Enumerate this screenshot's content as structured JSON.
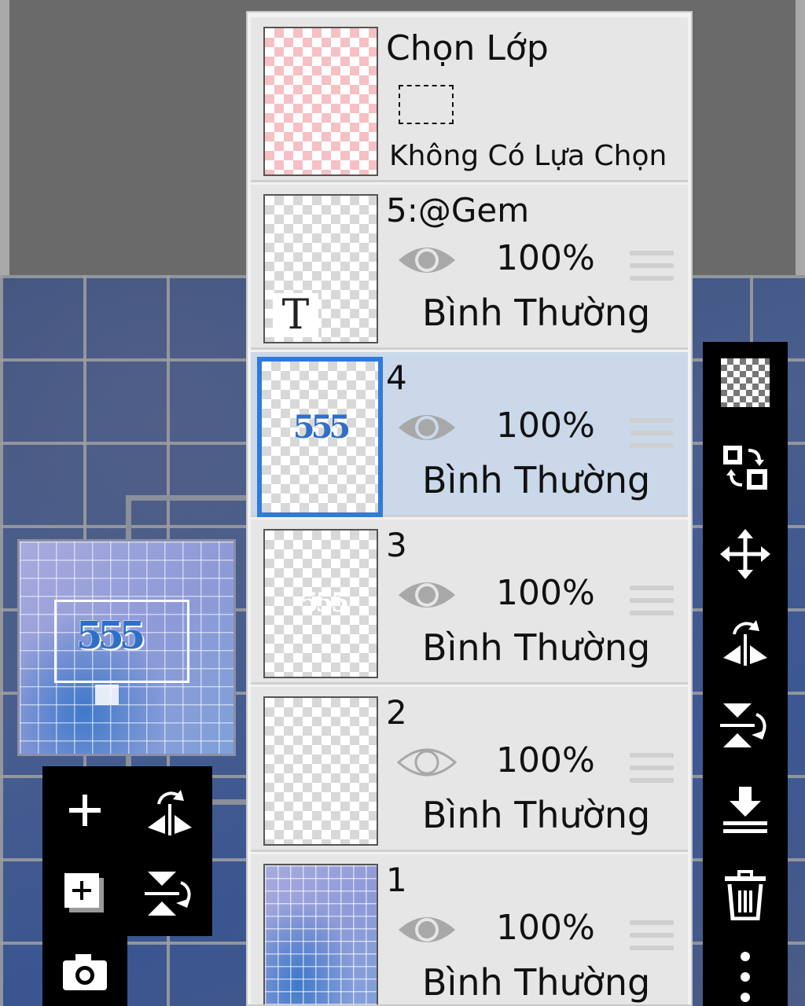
{
  "selection_layer": {
    "title": "Chọn Lớp",
    "status": "Không Có Lựa Chọn"
  },
  "layers": [
    {
      "name": "5:@Gem",
      "opacity": "100%",
      "blend": "Bình Thường",
      "visible": true,
      "selected": false,
      "thumbnail": "text-T"
    },
    {
      "name": "4",
      "opacity": "100%",
      "blend": "Bình Thường",
      "visible": true,
      "selected": true,
      "thumbnail_text": "555"
    },
    {
      "name": "3",
      "opacity": "100%",
      "blend": "Bình Thường",
      "visible": true,
      "selected": false
    },
    {
      "name": "2",
      "opacity": "100%",
      "blend": "Bình Thường",
      "visible": false,
      "selected": false
    },
    {
      "name": "1",
      "opacity": "100%",
      "blend": "Bình Thường",
      "visible": true,
      "selected": false
    }
  ],
  "navigator": {
    "text": "555"
  },
  "colors": {
    "selected_row": "#cad8ea",
    "selected_border": "#2f7bdc",
    "toolbar": "#000000"
  },
  "toolbar_left_icons": [
    "plus-icon",
    "flip-horizontal-icon",
    "add-layer-icon",
    "flip-vertical-icon",
    "camera-icon"
  ],
  "toolbar_right_icons": [
    "transparent-checker-icon",
    "swap-layers-icon",
    "move-icon",
    "flip-horizontal-icon",
    "flip-vertical-icon",
    "merge-down-icon",
    "trash-icon",
    "more-vertical-icon"
  ]
}
